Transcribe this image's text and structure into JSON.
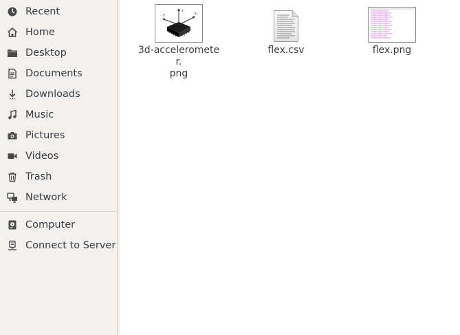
{
  "sidebar": {
    "items": [
      {
        "label": "Recent",
        "icon": "clock-icon"
      },
      {
        "label": "Home",
        "icon": "home-icon"
      },
      {
        "label": "Desktop",
        "icon": "folder-icon"
      },
      {
        "label": "Documents",
        "icon": "document-icon"
      },
      {
        "label": "Downloads",
        "icon": "download-icon"
      },
      {
        "label": "Music",
        "icon": "music-icon"
      },
      {
        "label": "Pictures",
        "icon": "camera-icon"
      },
      {
        "label": "Videos",
        "icon": "video-icon"
      },
      {
        "label": "Trash",
        "icon": "trash-icon"
      },
      {
        "label": "Network",
        "icon": "network-icon"
      },
      {
        "label": "Computer",
        "icon": "drive-icon"
      },
      {
        "label": "Connect to Server",
        "icon": "server-icon"
      }
    ]
  },
  "files": [
    {
      "name_line1": "3d-accelerometer.",
      "name_line2": "png",
      "type": "image-thumbnail"
    },
    {
      "name_line1": "flex.csv",
      "name_line2": "",
      "type": "text-document"
    },
    {
      "name_line1": "flex.png",
      "name_line2": "",
      "type": "image-thumbnail"
    }
  ],
  "colors": {
    "sidebar_bg": "#f2f1f0",
    "text": "#3c3c3c",
    "icon": "#4a4a4a"
  }
}
